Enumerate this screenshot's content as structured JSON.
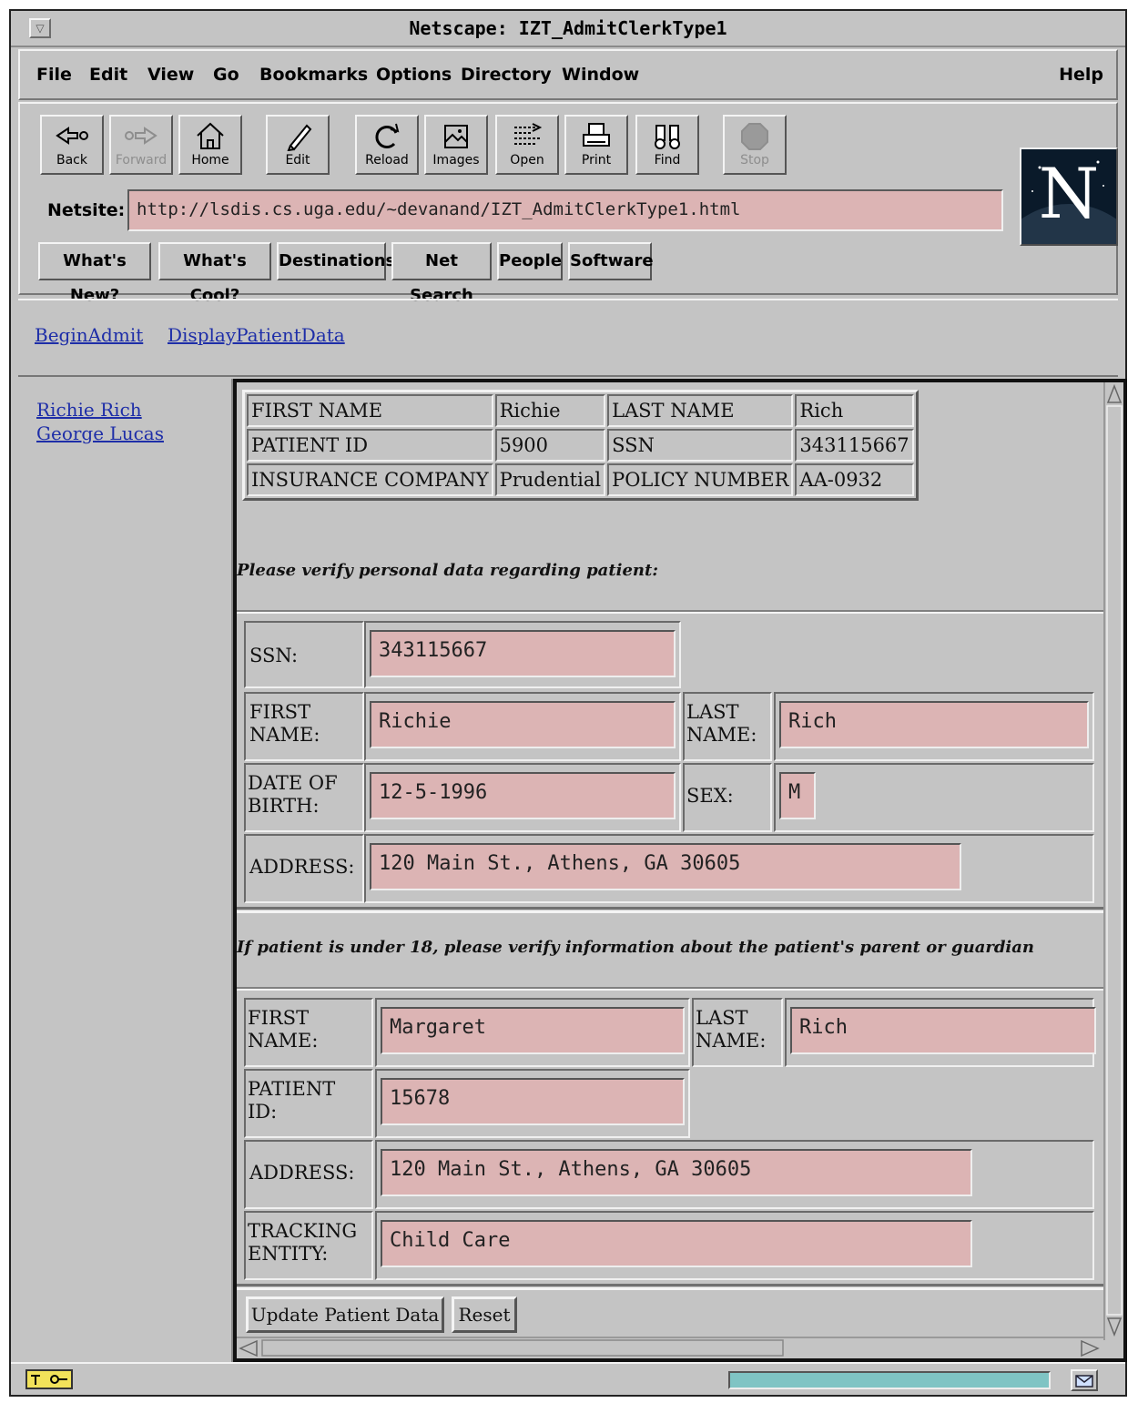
{
  "window": {
    "title": "Netscape: IZT_AdmitClerkType1"
  },
  "menu": [
    "File",
    "Edit",
    "View",
    "Go",
    "Bookmarks",
    "Options",
    "Directory",
    "Window"
  ],
  "menu_help": "Help",
  "toolbar": [
    {
      "label": "Back",
      "icon": "back-arrow-icon",
      "enabled": true
    },
    {
      "label": "Forward",
      "icon": "forward-arrow-icon",
      "enabled": false
    },
    {
      "label": "Home",
      "icon": "home-icon",
      "enabled": true
    },
    {
      "label": "Edit",
      "icon": "pencil-icon",
      "enabled": true
    },
    {
      "label": "Reload",
      "icon": "reload-icon",
      "enabled": true
    },
    {
      "label": "Images",
      "icon": "images-icon",
      "enabled": true
    },
    {
      "label": "Open",
      "icon": "open-icon",
      "enabled": true
    },
    {
      "label": "Print",
      "icon": "printer-icon",
      "enabled": true
    },
    {
      "label": "Find",
      "icon": "binoculars-icon",
      "enabled": true
    },
    {
      "label": "Stop",
      "icon": "stop-icon",
      "enabled": false
    }
  ],
  "location": {
    "label": "Netsite:",
    "url": "http://lsdis.cs.uga.edu/~devanand/IZT_AdmitClerkType1.html"
  },
  "directory_buttons": [
    "What's New?",
    "What's Cool?",
    "Destinations",
    "Net Search",
    "People",
    "Software"
  ],
  "top_links": [
    "BeginAdmit",
    "DisplayPatientData"
  ],
  "left_links": [
    "Richie Rich",
    "George Lucas"
  ],
  "summary": {
    "rows": [
      [
        "FIRST NAME",
        "Richie",
        "LAST NAME",
        "Rich"
      ],
      [
        "PATIENT ID",
        "5900",
        "SSN",
        "343115667"
      ],
      [
        "INSURANCE COMPANY",
        "Prudential",
        "POLICY NUMBER",
        "AA-0932"
      ]
    ]
  },
  "patient_prompt": "Please verify personal data regarding patient:",
  "patient_form": {
    "ssn_label": "SSN:",
    "ssn": "343115667",
    "first_label": "FIRST NAME:",
    "first": "Richie",
    "last_label": "LAST NAME:",
    "last": "Rich",
    "dob_label": "DATE OF BIRTH:",
    "dob": "12-5-1996",
    "sex_label": "SEX:",
    "sex": "M",
    "address_label": "ADDRESS:",
    "address": "120 Main St., Athens, GA 30605"
  },
  "guardian_prompt": "If patient is under 18, please verify information about the patient's parent or guardian",
  "guardian_form": {
    "first_label": "FIRST NAME:",
    "first": "Margaret",
    "last_label": "LAST NAME:",
    "last": "Rich",
    "pid_label": "PATIENT ID:",
    "pid": "15678",
    "address_label": "ADDRESS:",
    "address": "120 Main St., Athens, GA 30605",
    "tracking_label": "TRACKING ENTITY:",
    "tracking": "Child Care"
  },
  "buttons": {
    "update": "Update Patient Data",
    "reset": "Reset"
  },
  "colors": {
    "chrome": "#c4c4c4",
    "field": "#dcb4b4",
    "link": "#1e2ea8",
    "progress": "#7fc4c4"
  }
}
